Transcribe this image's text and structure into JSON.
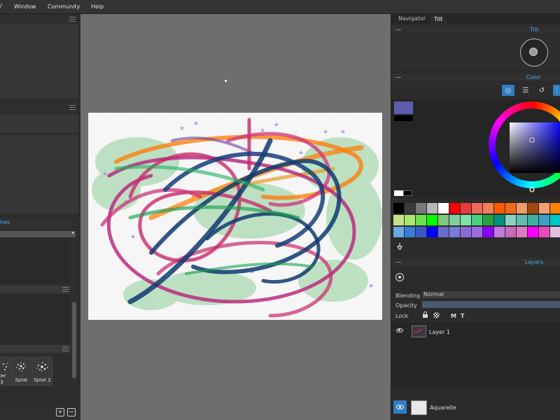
{
  "menu": {
    "items": [
      "Window",
      "Community",
      "Help"
    ]
  },
  "left_panel": {
    "section_label_partial": "hes",
    "brushes": [
      {
        "label": "tter",
        "sublabel": "3"
      },
      {
        "label": "Splat"
      },
      {
        "label": "Splat 2"
      }
    ]
  },
  "right_panel": {
    "tabs": [
      "Navigator",
      "Tilt"
    ],
    "tilt_title": "Tilt",
    "color_title": "Color",
    "layers_title": "Layers",
    "primary_color": "#5c5cab",
    "secondary_color": "#000000",
    "color_icons": [
      "target-icon",
      "sliders-icon",
      "history-icon",
      "grid-icon"
    ],
    "palette": [
      [
        "#000000",
        "#3a3a3a",
        "#7a7a7a",
        "#b8b8b8",
        "#ffffff",
        "#ff0000",
        "#e83a3a",
        "#ec6b5a",
        "#f07f5a",
        "#ff5a00",
        "#f06a1c",
        "#f29a6a",
        "#a04a10",
        "#f4a070",
        "#ff8000"
      ],
      [
        "#c8e08a",
        "#a8e86a",
        "#6ae04a",
        "#00ff00",
        "#7ec87e",
        "#7ed0a0",
        "#7ee0a8",
        "#4ad07a",
        "#28a040",
        "#009080",
        "#8ed0c0",
        "#60c0b0",
        "#40b0a0",
        "#3aa0c8",
        "#00c8c8"
      ],
      [
        "#6aa8e8",
        "#3a7ad8",
        "#3a5ac8",
        "#0000ff",
        "#6a6ac8",
        "#7a7ad8",
        "#8a6ad8",
        "#a06ae0",
        "#8a00ff",
        "#c07ae0",
        "#c86ab8",
        "#e07ac0",
        "#ff00ff",
        "#e84ab8",
        "#e0c0e0"
      ]
    ],
    "blending_label": "Blending",
    "blending_value": "Normal",
    "opacity_label": "Opacity",
    "lock_label": "Lock",
    "lock_icons": [
      "lock-icon",
      "checker-lock-icon"
    ],
    "lock_letters": [
      "M",
      "T"
    ],
    "layers": [
      {
        "name": "Layer 1"
      }
    ],
    "base_layer": {
      "name": "Aquarelle"
    }
  }
}
